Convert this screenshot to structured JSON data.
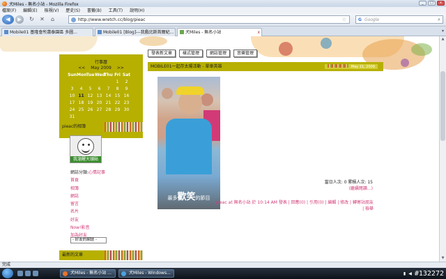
{
  "window": {
    "title": "犬Miles - 無名小站 - Mozilla Firefox",
    "min": "_",
    "max": "□",
    "close": "x"
  },
  "menu": [
    "檔案(F)",
    "編輯(E)",
    "檢視(V)",
    "歷史(S)",
    "書籤(B)",
    "工具(T)",
    "說明(H)"
  ],
  "nav": {
    "back": "◀",
    "forward": "▶",
    "reload": "↻",
    "stop": "✕",
    "home": "⌂",
    "url": "http://www.wretch.cc/blog/pieac",
    "bookmark_star": "☆",
    "search_placeholder": "Google",
    "search_engine": "G",
    "search_btn": "⌕"
  },
  "tabs": [
    {
      "label": "Mobile01 基隆會所蕭泰園區 多圖...",
      "active": false
    },
    {
      "label": "Mobile01 [Blog]---我戲北斯首爾紀...",
      "active": false
    },
    {
      "label": "犬Miles - 無名小站",
      "active": true
    }
  ],
  "tab_list_btn": "▾",
  "blog": {
    "top_buttons": [
      "發表新文章",
      "樣式管理",
      "網誌管理",
      "音樂管理"
    ],
    "calendar": {
      "title": "行事曆",
      "prev": "<<",
      "month": "May 2009",
      "next": ">>",
      "weekdays": [
        "Sun",
        "Mon",
        "Tue",
        "Wed",
        "Thu",
        "Fri",
        "Sat"
      ],
      "days": [
        "",
        "",
        "",
        "",
        "",
        "1",
        "2",
        "3",
        "4",
        "5",
        "6",
        "7",
        "8",
        "9",
        "10",
        "11",
        "12",
        "13",
        "14",
        "15",
        "16",
        "17",
        "18",
        "19",
        "20",
        "21",
        "22",
        "23",
        "24",
        "25",
        "26",
        "27",
        "28",
        "29",
        "30",
        "31"
      ],
      "today": "11"
    },
    "album_head": "pieac的相簿",
    "avatar_band": "我溜醒大頭貼",
    "side_links": {
      "category_label": "網誌分類:",
      "category_value": "心情記事",
      "items": [
        "首頁",
        "相簿",
        "網誌",
        "留言",
        "名片",
        "好友",
        "Now!影音",
        "加為好友"
      ]
    },
    "friend_select": "- 好友的網誌 -",
    "bottom_head": "最新的文章",
    "post": {
      "title": "MOBILE01一起存太陽活動 - 單車英雄",
      "date": "May 11, 2009",
      "photo_caption_pre": "最多",
      "photo_caption_big": "歡笑",
      "photo_caption_post": "的節目",
      "stats": "當日人次: 0 累積人次: 15",
      "more": "(繼續閱讀...)",
      "footer": "pieac at 無名小站 於 10:14 AM 發表 | 回應(0) | 引用(0) | 編輯 | 修改 | 轉寄站朋友 | 檢舉"
    }
  },
  "status": "完成",
  "taskbar": {
    "buttons": [
      "犬Miles - 無名小站 ...",
      "犬Miles - Windows..."
    ],
    "clock": "#132272"
  }
}
